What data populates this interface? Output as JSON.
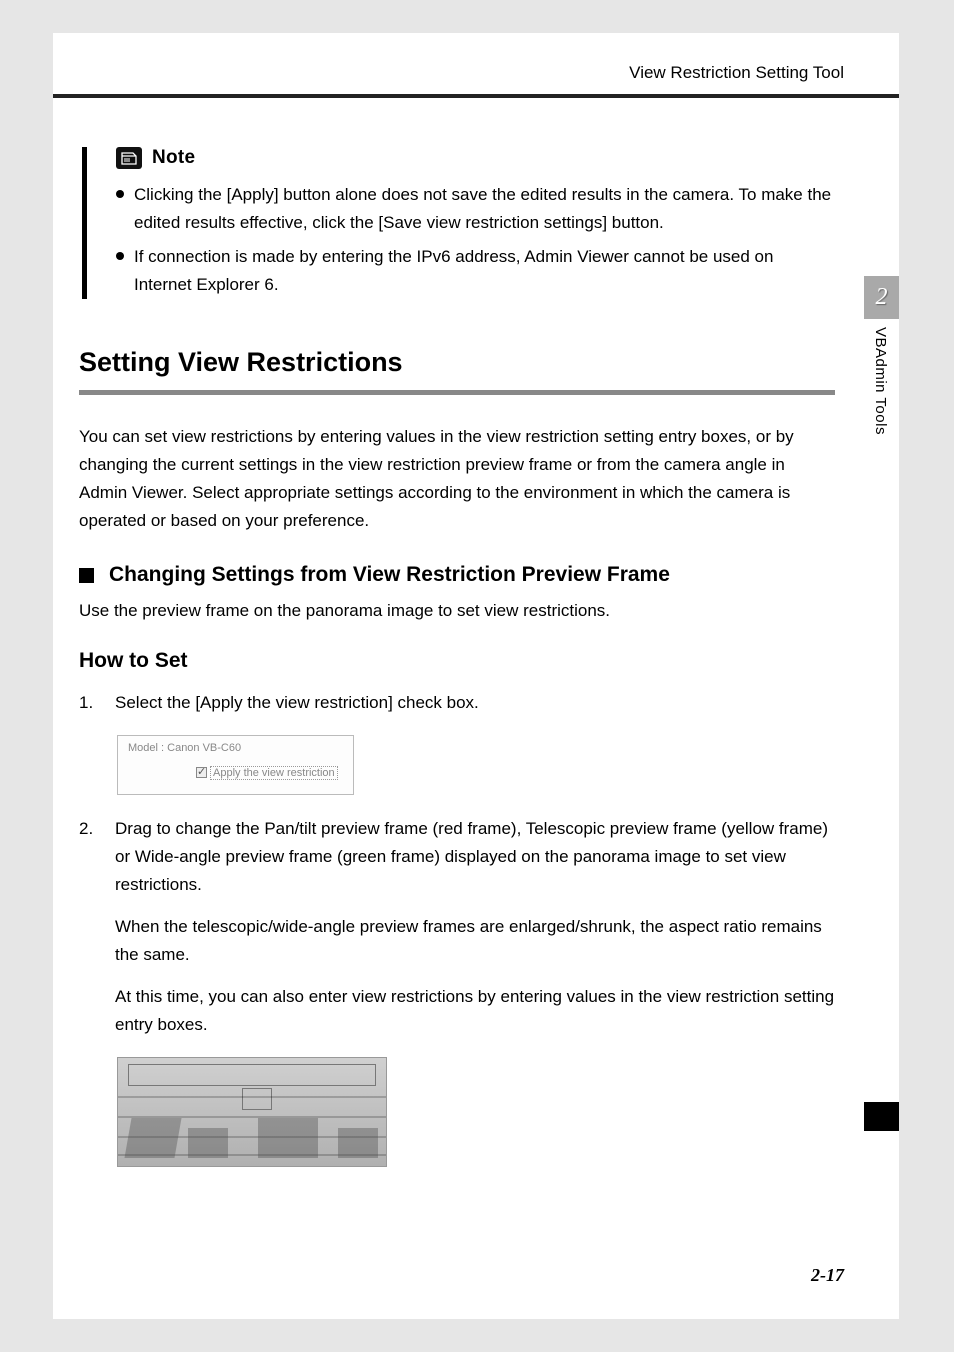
{
  "header": {
    "title": "View Restriction Setting Tool"
  },
  "sidebar": {
    "chapter_num": "2",
    "chapter_label": "VBAdmin Tools"
  },
  "note": {
    "title": "Note",
    "items": [
      {
        "pre": "Clicking the [",
        "bold1": "Apply",
        "mid": "] button alone does not save the edited results in the camera. To make the edited results effective, click the [",
        "bold2": "Save view restriction settings",
        "post": "] button."
      },
      {
        "text": "If connection is made by entering the IPv6 address, Admin Viewer cannot be used on Internet Explorer 6."
      }
    ]
  },
  "h1": "Setting View Restrictions",
  "intro": "You can set view restrictions by entering values in the view restriction setting entry boxes, or by changing the current settings in the view restriction preview frame or from the camera angle in Admin Viewer. Select appropriate settings according to the environment in which the camera is operated or based on your preference.",
  "h2": "Changing Settings from View Restriction Preview Frame",
  "h2_desc": "Use the preview frame on the panorama image to set view restrictions.",
  "h3": "How to Set",
  "steps": [
    {
      "num": "1.",
      "paras": [
        "Select the [Apply the view restriction] check box."
      ]
    },
    {
      "num": "2.",
      "paras": [
        "Drag to change the Pan/tilt preview frame (red frame), Telescopic preview frame (yellow frame) or Wide-angle preview frame (green frame) displayed on the panorama image to set view restrictions.",
        "When the telescopic/wide-angle preview frames are enlarged/shrunk, the aspect ratio remains the same.",
        "At this time, you can also enter view restrictions by entering values in the view restriction setting entry boxes."
      ]
    }
  ],
  "fig1": {
    "model": "Model :  Canon VB-C60",
    "checkbox_label": "Apply the view restriction"
  },
  "page_num": "2-17"
}
